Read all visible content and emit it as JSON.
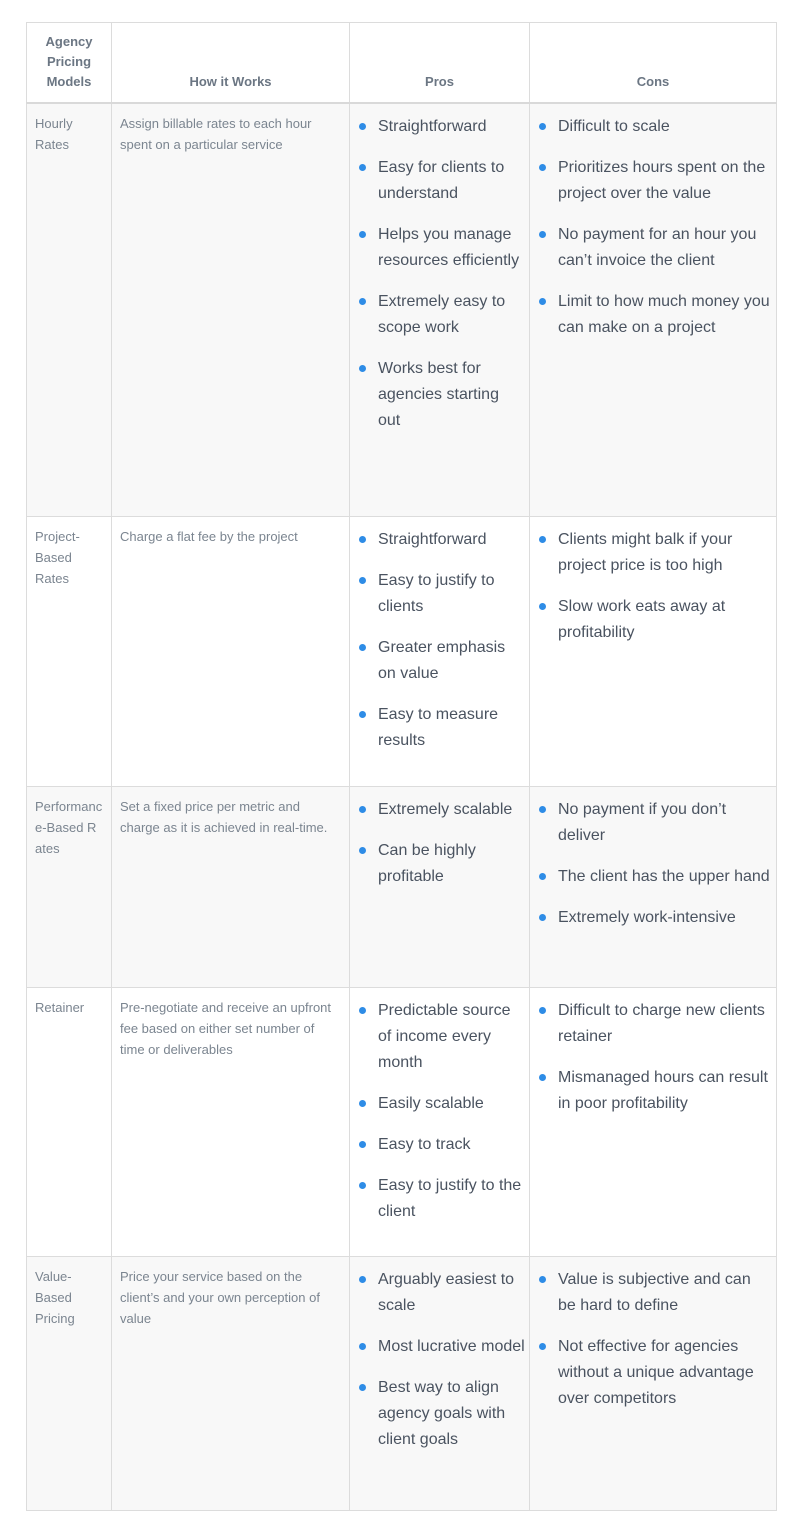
{
  "table": {
    "headers": [
      "Agency Pricing Models",
      "How it Works",
      "Pros",
      "Cons"
    ],
    "accent_color": "#2e8ce6",
    "rows": [
      {
        "model": "Hourly Rates",
        "how": "Assign billable rates to each hour spent on a particular service",
        "pros": [
          "Straightforward",
          "Easy for clients to understand",
          "Helps you manage resources efficiently",
          "Extremely easy to scope work",
          "Works best for agencies starting out"
        ],
        "cons": [
          "Difficult to scale",
          "Prioritizes hours spent on the project over the value",
          "No payment for an hour you can’t invoice the client",
          "Limit to how much money you can make on a project"
        ]
      },
      {
        "model": "Project-Based Rates",
        "how": "Charge a flat fee by the project",
        "pros": [
          "Straightforward",
          "Easy to justify to clients",
          "Greater emphasis on value",
          "Easy to measure results"
        ],
        "cons": [
          "Clients might balk if your project price is too high",
          "Slow work eats away at profitability"
        ]
      },
      {
        "model": "Performance-Based Rates",
        "how": "Set a fixed price per metric and charge as it is achieved in real-time.",
        "pros": [
          "Extremely scalable",
          "Can be highly profitable"
        ],
        "cons": [
          "No payment if you don’t deliver",
          "The client has the upper hand",
          "Extremely work-intensive"
        ]
      },
      {
        "model": "Retainer",
        "how": "Pre-negotiate and receive an upfront fee based on either set number of time or deliverables",
        "pros": [
          "Predictable source of income every month",
          "Easily scalable",
          "Easy to track",
          "Easy to justify to the client"
        ],
        "cons": [
          "Difficult to charge new clients retainer",
          "Mismanaged hours can result in poor profitability"
        ]
      },
      {
        "model": "Value-Based Pricing",
        "how": "Price your service based on the client’s and your own perception of value",
        "pros": [
          "Arguably easiest to scale",
          "Most lucrative model",
          "Best way to align agency goals with client goals"
        ],
        "cons": [
          "Value is subjective and can be hard to define",
          "Not effective for agencies without a unique advantage over competitors"
        ]
      }
    ]
  }
}
